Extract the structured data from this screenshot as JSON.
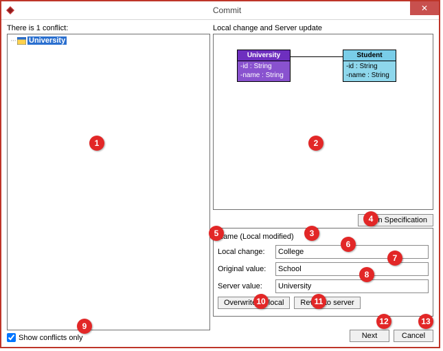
{
  "window": {
    "title": "Commit",
    "close_glyph": "✕"
  },
  "left": {
    "conflict_label": "There is 1 conflict:",
    "tree": {
      "item_name": "University"
    },
    "show_conflicts_label": "Show conflicts only"
  },
  "right": {
    "panel_label": "Local change and Server update",
    "open_spec_label": "Open Specification",
    "section_title": "Name (Local modified)",
    "fields": {
      "local_label": "Local change:",
      "local_value": "College",
      "original_label": "Original value:",
      "original_value": "School",
      "server_label": "Server value:",
      "server_value": "University"
    },
    "actions": {
      "overwrite_label": "Overwrite by local",
      "revert_label": "Revert to server"
    },
    "buttons": {
      "next_label": "Next",
      "cancel_label": "Cancel"
    }
  },
  "uml": {
    "university": {
      "name": "University",
      "attr1": "-id : String",
      "attr2": "-name : String"
    },
    "student": {
      "name": "Student",
      "attr1": "-id : String",
      "attr2": "-name : String"
    }
  },
  "callouts": [
    "1",
    "2",
    "3",
    "4",
    "5",
    "6",
    "7",
    "8",
    "9",
    "10",
    "11",
    "12",
    "13"
  ]
}
